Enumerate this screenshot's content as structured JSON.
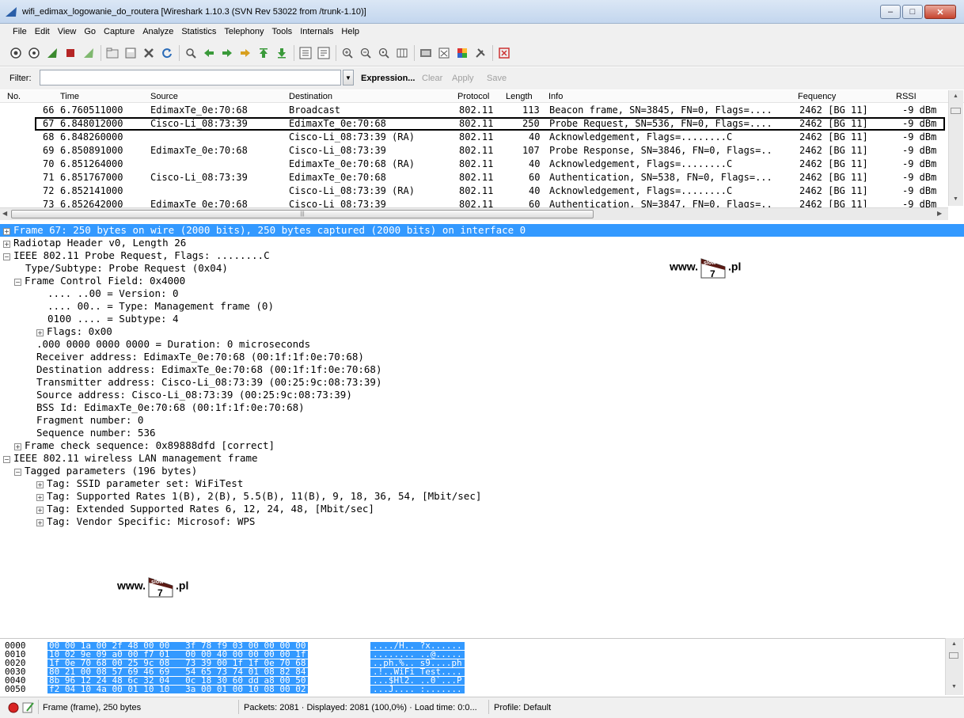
{
  "window": {
    "title": "wifi_edimax_logowanie_do_routera  [Wireshark 1.10.3  (SVN Rev 53022 from /trunk-1.10)]"
  },
  "menu": [
    "File",
    "Edit",
    "View",
    "Go",
    "Capture",
    "Analyze",
    "Statistics",
    "Telephony",
    "Tools",
    "Internals",
    "Help"
  ],
  "filter": {
    "label": "Filter:",
    "value": "",
    "expression": "Expression...",
    "clear": "Clear",
    "apply": "Apply",
    "save": "Save"
  },
  "packet_list": {
    "columns": [
      "No.",
      "Time",
      "Source",
      "Destination",
      "Protocol",
      "Length",
      "Info",
      "Fequency",
      "RSSI"
    ],
    "rows": [
      {
        "no": "66",
        "time": "6.760511000",
        "source": "EdimaxTe_0e:70:68",
        "destination": "Broadcast",
        "protocol": "802.11",
        "length": "113",
        "info": "Beacon frame, SN=3845, FN=0, Flags=....",
        "frequency": "2462 [BG 11]",
        "rssi": "-9 dBm"
      },
      {
        "no": "67",
        "time": "6.848012000",
        "source": "Cisco-Li_08:73:39",
        "destination": "EdimaxTe_0e:70:68",
        "protocol": "802.11",
        "length": "250",
        "info": "Probe Request, SN=536, FN=0, Flags=....",
        "frequency": "2462 [BG 11]",
        "rssi": "-9 dBm"
      },
      {
        "no": "68",
        "time": "6.848260000",
        "source": "",
        "destination": "Cisco-Li_08:73:39 (RA)",
        "protocol": "802.11",
        "length": "40",
        "info": "Acknowledgement, Flags=........C",
        "frequency": "2462 [BG 11]",
        "rssi": "-9 dBm"
      },
      {
        "no": "69",
        "time": "6.850891000",
        "source": "EdimaxTe_0e:70:68",
        "destination": "Cisco-Li_08:73:39",
        "protocol": "802.11",
        "length": "107",
        "info": "Probe Response, SN=3846, FN=0, Flags=..",
        "frequency": "2462 [BG 11]",
        "rssi": "-9 dBm"
      },
      {
        "no": "70",
        "time": "6.851264000",
        "source": "",
        "destination": "EdimaxTe_0e:70:68 (RA)",
        "protocol": "802.11",
        "length": "40",
        "info": "Acknowledgement, Flags=........C",
        "frequency": "2462 [BG 11]",
        "rssi": "-9 dBm"
      },
      {
        "no": "71",
        "time": "6.851767000",
        "source": "Cisco-Li_08:73:39",
        "destination": "EdimaxTe_0e:70:68",
        "protocol": "802.11",
        "length": "60",
        "info": "Authentication, SN=538, FN=0, Flags=...",
        "frequency": "2462 [BG 11]",
        "rssi": "-9 dBm"
      },
      {
        "no": "72",
        "time": "6.852141000",
        "source": "",
        "destination": "Cisco-Li_08:73:39 (RA)",
        "protocol": "802.11",
        "length": "40",
        "info": "Acknowledgement, Flags=........C",
        "frequency": "2462 [BG 11]",
        "rssi": "-9 dBm"
      },
      {
        "no": "73",
        "time": "6.852642000",
        "source": "EdimaxTe_0e:70:68",
        "destination": "Cisco-Li_08:73:39",
        "protocol": "802.11",
        "length": "60",
        "info": "Authentication, SN=3847, FN=0, Flags=..",
        "frequency": "2462 [BG 11]",
        "rssi": "-9 dBm"
      }
    ]
  },
  "details": [
    {
      "text": "Frame 67: 250 bytes on wire (2000 bits), 250 bytes captured (2000 bits) on interface 0",
      "expander": "+"
    },
    {
      "text": "Radiotap Header v0, Length 26",
      "expander": "+"
    },
    {
      "text": "IEEE 802.11 Probe Request, Flags: ........C",
      "expander": "-"
    },
    {
      "text": "Type/Subtype: Probe Request (0x04)",
      "expander": ""
    },
    {
      "text": "Frame Control Field: 0x4000",
      "expander": "-"
    },
    {
      "text": ".... ..00 = Version: 0",
      "expander": ""
    },
    {
      "text": ".... 00.. = Type: Management frame (0)",
      "expander": ""
    },
    {
      "text": "0100 .... = Subtype: 4",
      "expander": ""
    },
    {
      "text": "Flags: 0x00",
      "expander": "+"
    },
    {
      "text": ".000 0000 0000 0000 = Duration: 0 microseconds",
      "expander": ""
    },
    {
      "text": "Receiver address: EdimaxTe_0e:70:68 (00:1f:1f:0e:70:68)",
      "expander": ""
    },
    {
      "text": "Destination address: EdimaxTe_0e:70:68 (00:1f:1f:0e:70:68)",
      "expander": ""
    },
    {
      "text": "Transmitter address: Cisco-Li_08:73:39 (00:25:9c:08:73:39)",
      "expander": ""
    },
    {
      "text": "Source address: Cisco-Li_08:73:39 (00:25:9c:08:73:39)",
      "expander": ""
    },
    {
      "text": "BSS Id: EdimaxTe_0e:70:68 (00:1f:1f:0e:70:68)",
      "expander": ""
    },
    {
      "text": "Fragment number: 0",
      "expander": ""
    },
    {
      "text": "Sequence number: 536",
      "expander": ""
    },
    {
      "text": "Frame check sequence: 0x89888dfd [correct]",
      "expander": "+"
    },
    {
      "text": "IEEE 802.11 wireless LAN management frame",
      "expander": "-"
    },
    {
      "text": "Tagged parameters (196 bytes)",
      "expander": "-"
    },
    {
      "text": "Tag: SSID parameter set: WiFiTest",
      "expander": "+"
    },
    {
      "text": "Tag: Supported Rates 1(B), 2(B), 5.5(B), 11(B), 9, 18, 36, 54, [Mbit/sec]",
      "expander": "+"
    },
    {
      "text": "Tag: Extended Supported Rates 6, 12, 24, 48, [Mbit/sec]",
      "expander": "+"
    },
    {
      "text": "Tag: Vendor Specific: Microsof: WPS",
      "expander": "+"
    }
  ],
  "watermark": {
    "prefix": "www.",
    "badge_top": "slow",
    "badge_num": "7",
    "suffix": ".pl"
  },
  "hex": [
    {
      "offset": "0000",
      "bytes": "00 00 1a 00 2f 48 00 00   3f 78 f9 03 00 00 00 00",
      "ascii": "..../H.. ?x......"
    },
    {
      "offset": "0010",
      "bytes": "10 02 9e 09 a0 00 f7 01   00 00 40 00 00 00 00 1f",
      "ascii": "........ ..@....."
    },
    {
      "offset": "0020",
      "bytes": "1f 0e 70 68 00 25 9c 08   73 39 00 1f 1f 0e 70 68",
      "ascii": "..ph.%.. s9....ph"
    },
    {
      "offset": "0030",
      "bytes": "80 21 00 08 57 69 46 69   54 65 73 74 01 08 82 84",
      "ascii": ".!..WiFi Test...."
    },
    {
      "offset": "0040",
      "bytes": "8b 96 12 24 48 6c 32 04   0c 18 30 60 dd a8 00 50",
      "ascii": "...$Hl2. ..0`...P"
    },
    {
      "offset": "0050",
      "bytes": "f2 04 10 4a 00 01 10 10   3a 00 01 00 10 08 00 02",
      "ascii": "...J.... :......."
    }
  ],
  "status": {
    "frame": "Frame (frame), 250 bytes",
    "packets": "Packets: 2081 · Displayed: 2081 (100,0%) · Load time: 0:0...",
    "profile": "Profile: Default"
  }
}
